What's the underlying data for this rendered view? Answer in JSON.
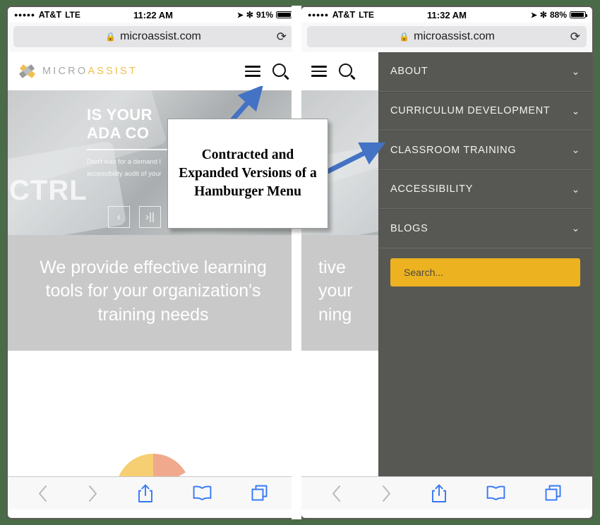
{
  "annotation": {
    "callout_text": "Contracted and Expanded Versions of a Hamburger Menu",
    "arrow_color": "#4472c4"
  },
  "phones": [
    {
      "id": "contracted",
      "status_bar": {
        "signal_dots": "●●●●●",
        "carrier": "AT&T",
        "network": "LTE",
        "time": "11:22 AM",
        "location_icon": "location-arrow",
        "bluetooth_icon": "bluetooth",
        "battery_percent": "91%",
        "battery_level": 91
      },
      "browser": {
        "url": "microassist.com",
        "lock_icon": "lock",
        "reload_icon": "reload"
      },
      "site_header": {
        "logo_primary": "MICRO",
        "logo_accent": "ASSIST",
        "menu_icon": "hamburger-menu-icon",
        "search_icon": "search-icon"
      },
      "hero": {
        "heading_line1": "IS YOUR",
        "heading_line2": "ADA CO",
        "subtitle_line1": "Don't wait for a demand l",
        "subtitle_line2": "accessibility audit of your",
        "overlay_text": "CTRL",
        "prev_label": "‹",
        "play_label": "›||"
      },
      "tagline": "We provide effective learning tools for your organization's training needs",
      "menu_open": false
    },
    {
      "id": "expanded",
      "status_bar": {
        "signal_dots": "●●●●●",
        "carrier": "AT&T",
        "network": "LTE",
        "time": "11:32 AM",
        "location_icon": "location-arrow",
        "bluetooth_icon": "bluetooth",
        "battery_percent": "88%",
        "battery_level": 88
      },
      "browser": {
        "url": "microassist.com",
        "lock_icon": "lock",
        "reload_icon": "reload"
      },
      "site_header": {
        "menu_icon": "hamburger-menu-icon",
        "search_icon": "search-icon"
      },
      "tagline_partial_line1": "tive",
      "tagline_partial_line2": "your",
      "tagline_partial_line3": "ning",
      "menu_open": true,
      "menu": {
        "background": "#575853",
        "items": [
          {
            "label": "ABOUT",
            "chevron": "⌄"
          },
          {
            "label": "CURRICULUM DEVELOPMENT",
            "chevron": "⌄"
          },
          {
            "label": "CLASSROOM TRAINING",
            "chevron": "⌄"
          },
          {
            "label": "ACCESSIBILITY",
            "chevron": "⌄"
          },
          {
            "label": "BLOGS",
            "chevron": "⌄"
          }
        ],
        "search_placeholder": "Search...",
        "search_color": "#edb21f"
      }
    }
  ],
  "toolbar": {
    "back_icon": "chevron-left-icon",
    "forward_icon": "chevron-right-icon",
    "share_icon": "share-icon",
    "bookmarks_icon": "book-icon",
    "tabs_icon": "tabs-icon"
  }
}
